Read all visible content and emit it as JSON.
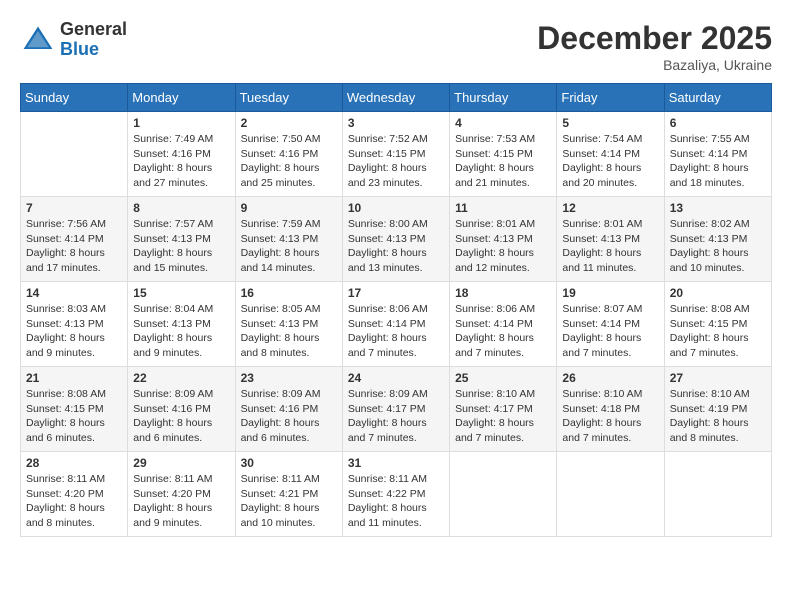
{
  "header": {
    "logo_general": "General",
    "logo_blue": "Blue",
    "title": "December 2025",
    "location": "Bazaliya, Ukraine"
  },
  "weekdays": [
    "Sunday",
    "Monday",
    "Tuesday",
    "Wednesday",
    "Thursday",
    "Friday",
    "Saturday"
  ],
  "weeks": [
    [
      {
        "day": null,
        "info": null
      },
      {
        "day": "1",
        "sunrise": "7:49 AM",
        "sunset": "4:16 PM",
        "daylight": "8 hours and 27 minutes."
      },
      {
        "day": "2",
        "sunrise": "7:50 AM",
        "sunset": "4:16 PM",
        "daylight": "8 hours and 25 minutes."
      },
      {
        "day": "3",
        "sunrise": "7:52 AM",
        "sunset": "4:15 PM",
        "daylight": "8 hours and 23 minutes."
      },
      {
        "day": "4",
        "sunrise": "7:53 AM",
        "sunset": "4:15 PM",
        "daylight": "8 hours and 21 minutes."
      },
      {
        "day": "5",
        "sunrise": "7:54 AM",
        "sunset": "4:14 PM",
        "daylight": "8 hours and 20 minutes."
      },
      {
        "day": "6",
        "sunrise": "7:55 AM",
        "sunset": "4:14 PM",
        "daylight": "8 hours and 18 minutes."
      }
    ],
    [
      {
        "day": "7",
        "sunrise": "7:56 AM",
        "sunset": "4:14 PM",
        "daylight": "8 hours and 17 minutes."
      },
      {
        "day": "8",
        "sunrise": "7:57 AM",
        "sunset": "4:13 PM",
        "daylight": "8 hours and 15 minutes."
      },
      {
        "day": "9",
        "sunrise": "7:59 AM",
        "sunset": "4:13 PM",
        "daylight": "8 hours and 14 minutes."
      },
      {
        "day": "10",
        "sunrise": "8:00 AM",
        "sunset": "4:13 PM",
        "daylight": "8 hours and 13 minutes."
      },
      {
        "day": "11",
        "sunrise": "8:01 AM",
        "sunset": "4:13 PM",
        "daylight": "8 hours and 12 minutes."
      },
      {
        "day": "12",
        "sunrise": "8:01 AM",
        "sunset": "4:13 PM",
        "daylight": "8 hours and 11 minutes."
      },
      {
        "day": "13",
        "sunrise": "8:02 AM",
        "sunset": "4:13 PM",
        "daylight": "8 hours and 10 minutes."
      }
    ],
    [
      {
        "day": "14",
        "sunrise": "8:03 AM",
        "sunset": "4:13 PM",
        "daylight": "8 hours and 9 minutes."
      },
      {
        "day": "15",
        "sunrise": "8:04 AM",
        "sunset": "4:13 PM",
        "daylight": "8 hours and 9 minutes."
      },
      {
        "day": "16",
        "sunrise": "8:05 AM",
        "sunset": "4:13 PM",
        "daylight": "8 hours and 8 minutes."
      },
      {
        "day": "17",
        "sunrise": "8:06 AM",
        "sunset": "4:14 PM",
        "daylight": "8 hours and 7 minutes."
      },
      {
        "day": "18",
        "sunrise": "8:06 AM",
        "sunset": "4:14 PM",
        "daylight": "8 hours and 7 minutes."
      },
      {
        "day": "19",
        "sunrise": "8:07 AM",
        "sunset": "4:14 PM",
        "daylight": "8 hours and 7 minutes."
      },
      {
        "day": "20",
        "sunrise": "8:08 AM",
        "sunset": "4:15 PM",
        "daylight": "8 hours and 7 minutes."
      }
    ],
    [
      {
        "day": "21",
        "sunrise": "8:08 AM",
        "sunset": "4:15 PM",
        "daylight": "8 hours and 6 minutes."
      },
      {
        "day": "22",
        "sunrise": "8:09 AM",
        "sunset": "4:16 PM",
        "daylight": "8 hours and 6 minutes."
      },
      {
        "day": "23",
        "sunrise": "8:09 AM",
        "sunset": "4:16 PM",
        "daylight": "8 hours and 6 minutes."
      },
      {
        "day": "24",
        "sunrise": "8:09 AM",
        "sunset": "4:17 PM",
        "daylight": "8 hours and 7 minutes."
      },
      {
        "day": "25",
        "sunrise": "8:10 AM",
        "sunset": "4:17 PM",
        "daylight": "8 hours and 7 minutes."
      },
      {
        "day": "26",
        "sunrise": "8:10 AM",
        "sunset": "4:18 PM",
        "daylight": "8 hours and 7 minutes."
      },
      {
        "day": "27",
        "sunrise": "8:10 AM",
        "sunset": "4:19 PM",
        "daylight": "8 hours and 8 minutes."
      }
    ],
    [
      {
        "day": "28",
        "sunrise": "8:11 AM",
        "sunset": "4:20 PM",
        "daylight": "8 hours and 8 minutes."
      },
      {
        "day": "29",
        "sunrise": "8:11 AM",
        "sunset": "4:20 PM",
        "daylight": "8 hours and 9 minutes."
      },
      {
        "day": "30",
        "sunrise": "8:11 AM",
        "sunset": "4:21 PM",
        "daylight": "8 hours and 10 minutes."
      },
      {
        "day": "31",
        "sunrise": "8:11 AM",
        "sunset": "4:22 PM",
        "daylight": "8 hours and 11 minutes."
      },
      {
        "day": null,
        "info": null
      },
      {
        "day": null,
        "info": null
      },
      {
        "day": null,
        "info": null
      }
    ]
  ],
  "labels": {
    "sunrise": "Sunrise:",
    "sunset": "Sunset:",
    "daylight": "Daylight:"
  }
}
